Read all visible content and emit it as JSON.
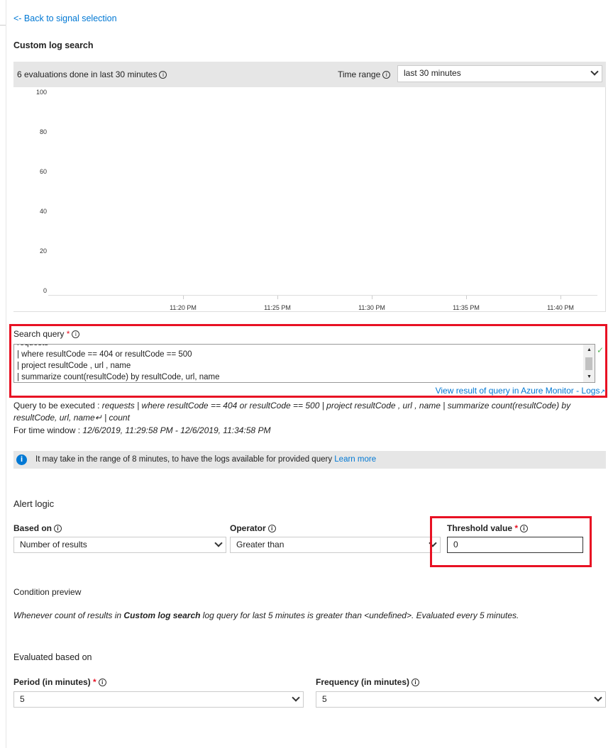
{
  "back_link": "<- Back to signal selection",
  "title": "Custom log search",
  "evaluations": {
    "text": "6 evaluations done in last 30 minutes",
    "time_range_label": "Time range",
    "time_range_value": "last 30 minutes"
  },
  "chart_data": {
    "type": "line",
    "series": [],
    "y_ticks": [
      "100",
      "80",
      "60",
      "40",
      "20",
      "0"
    ],
    "x_ticks": [
      "11:20 PM",
      "11:25 PM",
      "11:30 PM",
      "11:35 PM",
      "11:40 PM"
    ],
    "ylim": [
      0,
      100
    ]
  },
  "search_query": {
    "label": "Search query",
    "required": "*",
    "lines": [
      "requests",
      "| where resultCode == 404 or resultCode == 500",
      "| project resultCode , url , name",
      "| summarize count(resultCode) by resultCode, url, name"
    ],
    "view_link": "View result of query in Azure Monitor - Logs"
  },
  "query_exec": {
    "label": "Query to be executed : ",
    "value": "requests | where resultCode == 404 or resultCode == 500 | project resultCode , url , name | summarize count(resultCode) by resultCode, url, name↵ | count"
  },
  "time_window": {
    "label": "For time window : ",
    "value": "12/6/2019, 11:29:58 PM - 12/6/2019, 11:34:58 PM"
  },
  "info_bar": {
    "text": "It may take in the range of 8 minutes, to have the logs available for provided query ",
    "link": "Learn more"
  },
  "alert_logic": {
    "heading": "Alert logic",
    "based_on_label": "Based on",
    "based_on_value": "Number of results",
    "operator_label": "Operator",
    "operator_value": "Greater than",
    "threshold_label": "Threshold value",
    "threshold_value": "0"
  },
  "condition": {
    "heading": "Condition preview",
    "pre": "Whenever count of results in ",
    "bold": "Custom log search",
    "post": " log query for last 5 minutes is greater than <undefined>. Evaluated every 5 minutes."
  },
  "evaluated": {
    "heading": "Evaluated based on",
    "period_label": "Period (in minutes)",
    "period_value": "5",
    "frequency_label": "Frequency (in minutes)",
    "frequency_value": "5"
  }
}
